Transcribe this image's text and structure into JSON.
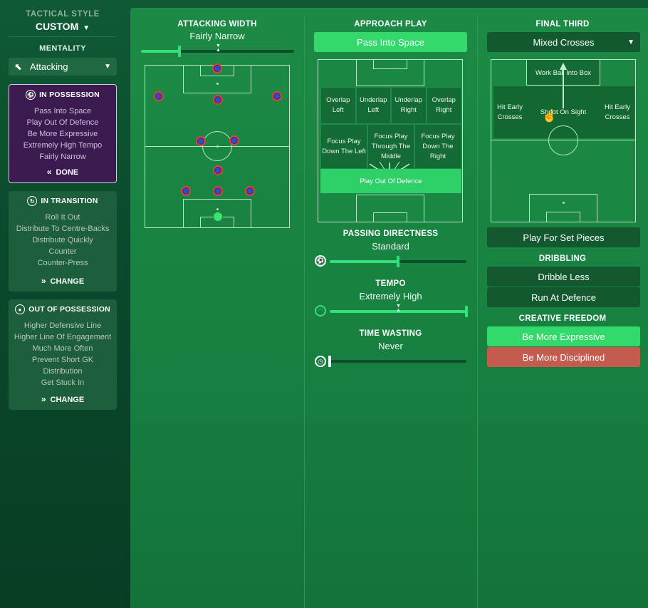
{
  "sidebar": {
    "tactical_style_label": "TACTICAL STYLE",
    "tactical_style_value": "CUSTOM",
    "mentality_label": "MENTALITY",
    "mentality_value": "Attacking",
    "in_possession": {
      "title": "IN POSSESSION",
      "items": [
        "Pass Into Space",
        "Play Out Of Defence",
        "Be More Expressive",
        "Extremely High Tempo",
        "Fairly Narrow"
      ],
      "action": "DONE"
    },
    "in_transition": {
      "title": "IN TRANSITION",
      "items": [
        "Roll It Out",
        "Distribute To Centre-Backs",
        "Distribute Quickly",
        "Counter",
        "Counter-Press"
      ],
      "action": "CHANGE"
    },
    "out_of_possession": {
      "title": "OUT OF POSSESSION",
      "items": [
        "Higher Defensive Line",
        "Higher Line Of Engagement",
        "Much More Often",
        "Prevent Short GK",
        "Distribution",
        "Get Stuck In"
      ],
      "action": "CHANGE"
    }
  },
  "attacking_width": {
    "title": "ATTACKING WIDTH",
    "value": "Fairly Narrow",
    "level": 0.25
  },
  "approach_play": {
    "title": "APPROACH PLAY",
    "selected": "Pass Into Space",
    "zones_row1": [
      "Overlap Left",
      "Underlap Left",
      "Underlap Right",
      "Overlap Right"
    ],
    "zones_row2": [
      "Focus Play Down The Left",
      "Focus Play Through The Middle",
      "Focus Play Down The Right"
    ],
    "highlight": "Play Out Of Defence"
  },
  "passing_directness": {
    "title": "PASSING DIRECTNESS",
    "value": "Standard",
    "level": 0.5
  },
  "tempo": {
    "title": "TEMPO",
    "value": "Extremely High",
    "level": 1.0
  },
  "time_wasting": {
    "title": "TIME WASTING",
    "value": "Never",
    "level": 0.0
  },
  "final_third": {
    "title": "FINAL THIRD",
    "selected": "Mixed Crosses",
    "zone_top": "Work Ball Into Box",
    "zone_left": "Hit Early Crosses",
    "zone_center": "Shoot On Sight",
    "zone_right": "Hit Early Crosses",
    "set_pieces": "Play For Set Pieces"
  },
  "dribbling": {
    "title": "DRIBBLING",
    "options": [
      "Dribble Less",
      "Run At Defence"
    ]
  },
  "creative_freedom": {
    "title": "CREATIVE FREEDOM",
    "options": [
      "Be More Expressive",
      "Be More Disciplined"
    ]
  },
  "colors": {
    "accent_green": "#33d96b",
    "possession_purple": "#3a1a4f",
    "disciplined_red": "#c35c4e"
  }
}
